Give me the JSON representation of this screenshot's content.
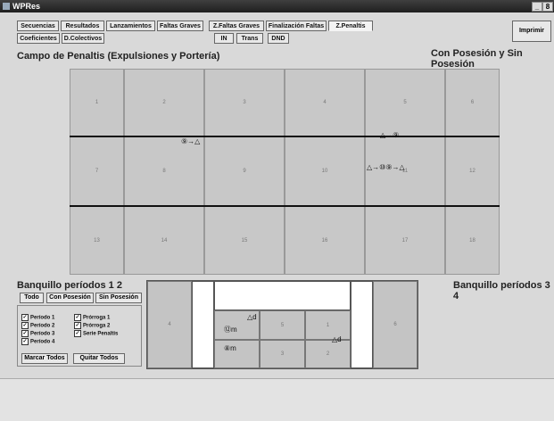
{
  "window": {
    "title": "WPRes",
    "minimize": "_",
    "maximize": "8",
    "close": "x"
  },
  "tabs_row1": [
    {
      "label": "Secuencias"
    },
    {
      "label": "Resultados"
    },
    {
      "label": "Lanzamientos"
    },
    {
      "label": "Faltas Graves"
    },
    {
      "label": "Z.Faltas Graves"
    },
    {
      "label": "Finalización Faltas"
    },
    {
      "label": "Z.Penaltis"
    }
  ],
  "tabs_row2": [
    {
      "label": "Coeficientes"
    },
    {
      "label": "D.Colectivos"
    },
    {
      "label": "IN"
    },
    {
      "label": "Trans"
    },
    {
      "label": "DND"
    }
  ],
  "print_label": "Imprimir",
  "court": {
    "title": "Campo de Penaltis (Expulsiones y Portería)",
    "mode": "Con Posesión y Sin Posesión",
    "zones": [
      "1",
      "2",
      "3",
      "4",
      "5",
      "6",
      "7",
      "8",
      "9",
      "10",
      "11",
      "12",
      "13",
      "14",
      "15",
      "16",
      "17",
      "18"
    ],
    "markers": [
      "⑨→△",
      "△→⑨",
      "△→⑩⑨→△"
    ]
  },
  "bench_left": {
    "title": "Banquillo períodos 1 2",
    "filters": [
      "Todo",
      "Con Posesión",
      "Sin Posesión"
    ],
    "periods": [
      {
        "label": "Período 1",
        "checked": true
      },
      {
        "label": "Prórroga 1",
        "checked": true
      },
      {
        "label": "Período 2",
        "checked": true
      },
      {
        "label": "Prórroga 2",
        "checked": true
      },
      {
        "label": "Período 3",
        "checked": true
      },
      {
        "label": "Serie Penaltis",
        "checked": true
      },
      {
        "label": "Período 4",
        "checked": true
      }
    ],
    "mark_all": "Marcar Todos",
    "clear_all": "Quitar Todos",
    "check_glyph": "✓"
  },
  "bench_right": {
    "title": "Banquillo períodos 3 4"
  },
  "bench_grid": {
    "zones": [
      "4",
      "6",
      "1",
      "5",
      "3",
      "2",
      "1"
    ],
    "markers": [
      "⑫m",
      "⑧m",
      "△d",
      "△d"
    ]
  },
  "colors": {
    "titlebar": "#2a2a2a",
    "cell": "#c8c8c8",
    "line": "#111111"
  }
}
